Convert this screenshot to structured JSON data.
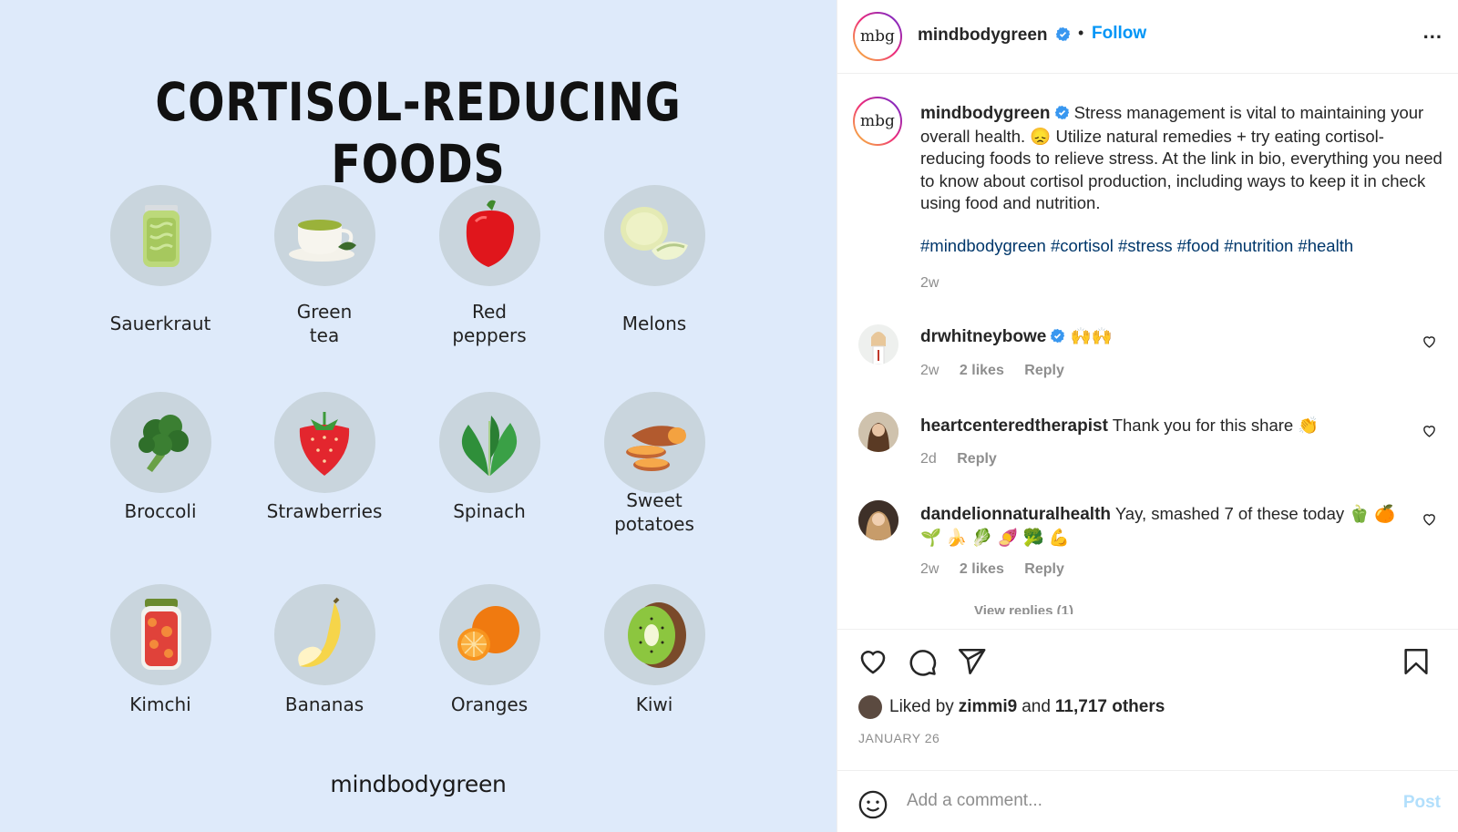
{
  "poster": {
    "title": "CORTISOL-REDUCING FOODS",
    "brand": "mindbodygreen",
    "foods": [
      {
        "label": "Sauerkraut",
        "icon": "sauerkraut-jar-icon"
      },
      {
        "label": "Green\ntea",
        "icon": "green-tea-cup-icon"
      },
      {
        "label": "Red\npeppers",
        "icon": "red-pepper-icon"
      },
      {
        "label": "Melons",
        "icon": "melon-icon"
      },
      {
        "label": "Broccoli",
        "icon": "broccoli-icon"
      },
      {
        "label": "Strawberries",
        "icon": "strawberry-icon"
      },
      {
        "label": "Spinach",
        "icon": "spinach-icon"
      },
      {
        "label": "Sweet\npotatoes",
        "icon": "sweet-potato-icon"
      },
      {
        "label": "Kimchi",
        "icon": "kimchi-jar-icon"
      },
      {
        "label": "Bananas",
        "icon": "banana-icon"
      },
      {
        "label": "Oranges",
        "icon": "orange-icon"
      },
      {
        "label": "Kiwi",
        "icon": "kiwi-icon"
      }
    ]
  },
  "header": {
    "avatar_text": "mbg",
    "username": "mindbodygreen",
    "separator": "•",
    "follow_label": "Follow",
    "more_label": "..."
  },
  "caption": {
    "avatar_text": "mbg",
    "username": "mindbodygreen",
    "text": "Stress management is vital to maintaining your overall health. 😞 Utilize natural remedies + try eating cortisol-reducing foods to relieve stress. At the link in bio, everything you need to know about cortisol production, including ways to keep it in check using food and nutrition.",
    "hashtags": "#mindbodygreen #cortisol #stress #food #nutrition #health",
    "time": "2w"
  },
  "comments": [
    {
      "username": "drwhitneybowe",
      "verified": true,
      "text": "🙌🙌",
      "time": "2w",
      "likes": "2 likes",
      "reply": "Reply"
    },
    {
      "username": "heartcenteredtherapist",
      "verified": false,
      "text": "Thank you for this share 👏",
      "time": "2d",
      "likes": "",
      "reply": "Reply"
    },
    {
      "username": "dandelionnaturalhealth",
      "verified": false,
      "text": "Yay, smashed 7 of these today 🫑 🍊 🌱 🍌 🥬 🍠 🥦 💪",
      "time": "2w",
      "likes": "2 likes",
      "reply": "Reply"
    }
  ],
  "view_replies": "View replies (1)",
  "likes": {
    "prefix": "Liked by",
    "user": "zimmi9",
    "and": "and",
    "others": "11,717 others"
  },
  "date": "JANUARY 26",
  "add_comment": {
    "placeholder": "Add a comment...",
    "post_label": "Post"
  },
  "colors": {
    "link_blue": "#0095f6",
    "hashtag": "#00376b",
    "muted": "#8e8e8e",
    "poster_bg": "#deeafa",
    "food_circle": "#c9d5dd"
  }
}
